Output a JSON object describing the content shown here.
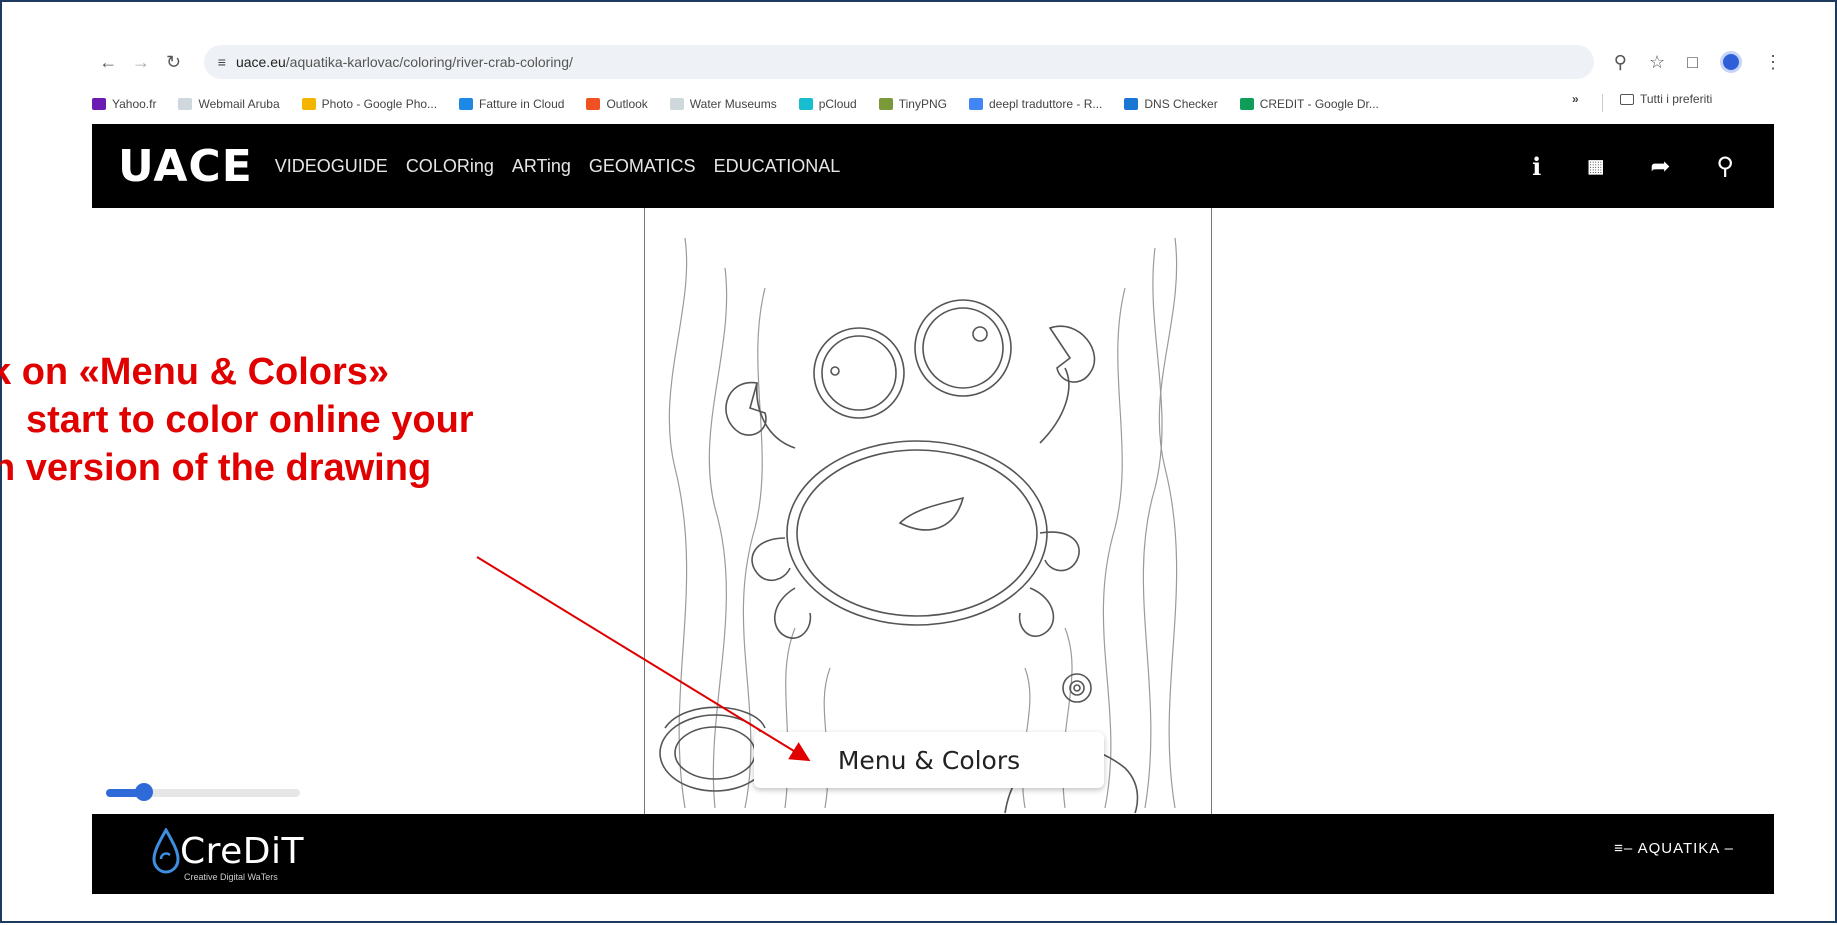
{
  "browser": {
    "url_domain": "uace.eu",
    "url_path": "/aquatika-karlovac/coloring/river-crab-coloring/",
    "bookmarks": [
      {
        "label": "Yahoo.fr",
        "color": "#6a1bb3"
      },
      {
        "label": "Webmail Aruba",
        "color": "#cfd8dc"
      },
      {
        "label": "Photo - Google Pho...",
        "color": "#f4b400"
      },
      {
        "label": "Fatture in Cloud",
        "color": "#1e88e5"
      },
      {
        "label": "Outlook",
        "color": "#f25022"
      },
      {
        "label": "Water Museums",
        "color": "#cfd8dc"
      },
      {
        "label": "pCloud",
        "color": "#17bed0"
      },
      {
        "label": "TinyPNG",
        "color": "#7a9a3a"
      },
      {
        "label": "deepl traduttore - R...",
        "color": "#4285f4"
      },
      {
        "label": "DNS Checker",
        "color": "#1976d2"
      },
      {
        "label": "CREDIT - Google Dr...",
        "color": "#0f9d58"
      }
    ],
    "bookmarks_more": "»",
    "all_bookmarks": "Tutti i preferiti"
  },
  "site": {
    "logo": "UACE",
    "nav": [
      "VIDEOGUIDE",
      "COLORing",
      "ARTing",
      "GEOMATICS",
      "EDUCATIONAL"
    ],
    "header_icons": [
      "info-icon",
      "uace-mark-icon",
      "share-icon",
      "search-icon"
    ],
    "menu_button_label": "Menu & Colors",
    "slider_value_fraction": 0.18,
    "footer_left_brand": "CreDiT",
    "footer_left_tagline": "Creative Digital WaTers",
    "footer_right_brand": "AQUATIKA"
  },
  "annotation": {
    "line1": "k on «Menu & Colors»",
    "line2": "start to color online your",
    "line3": "n version of the drawing",
    "color": "#e00000"
  }
}
